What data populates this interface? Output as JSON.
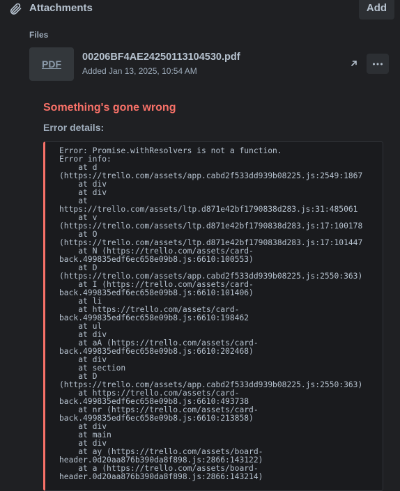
{
  "header": {
    "title": "Attachments",
    "add_label": "Add"
  },
  "files": {
    "label": "Files",
    "items": [
      {
        "type_label": "PDF",
        "name": "00206BF4AE24250113104530.pdf",
        "added": "Added Jan 13, 2025, 10:54 AM"
      }
    ]
  },
  "error": {
    "title": "Something's gone wrong",
    "details_label": "Error details:",
    "text": "Error: Promise.withResolvers is not a function.\nError info:\n    at d\n(https://trello.com/assets/app.cabd2f533dd939b08225.js:2549:1867\n    at div\n    at div\n    at\nhttps://trello.com/assets/ltp.d871e42bf1790838d283.js:31:485061\n    at v\n(https://trello.com/assets/ltp.d871e42bf1790838d283.js:17:100178\n    at O\n(https://trello.com/assets/ltp.d871e42bf1790838d283.js:17:101447\n    at N (https://trello.com/assets/card-\nback.499835edf6ec658e09b8.js:6610:100553)\n    at D\n(https://trello.com/assets/app.cabd2f533dd939b08225.js:2550:363)\n    at I (https://trello.com/assets/card-\nback.499835edf6ec658e09b8.js:6610:101406)\n    at li\n    at https://trello.com/assets/card-\nback.499835edf6ec658e09b8.js:6610:198462\n    at ul\n    at div\n    at aA (https://trello.com/assets/card-\nback.499835edf6ec658e09b8.js:6610:202468)\n    at div\n    at section\n    at D\n(https://trello.com/assets/app.cabd2f533dd939b08225.js:2550:363)\n    at https://trello.com/assets/card-\nback.499835edf6ec658e09b8.js:6610:493738\n    at nr (https://trello.com/assets/card-\nback.499835edf6ec658e09b8.js:6610:213858)\n    at div\n    at main\n    at div\n    at ay (https://trello.com/assets/board-\nheader.0d20aa876b390da8f898.js:2866:143122)\n    at a (https://trello.com/assets/board-\nheader.0d20aa876b390da8f898.js:2866:143214)"
  },
  "icons": {
    "attachments": "paperclip-icon",
    "open": "open-external-icon",
    "more": "more-options-icon"
  },
  "colors": {
    "background": "#1f2023",
    "text": "#b6c2cf",
    "error": "#f87168",
    "button": "#2c2f33"
  }
}
